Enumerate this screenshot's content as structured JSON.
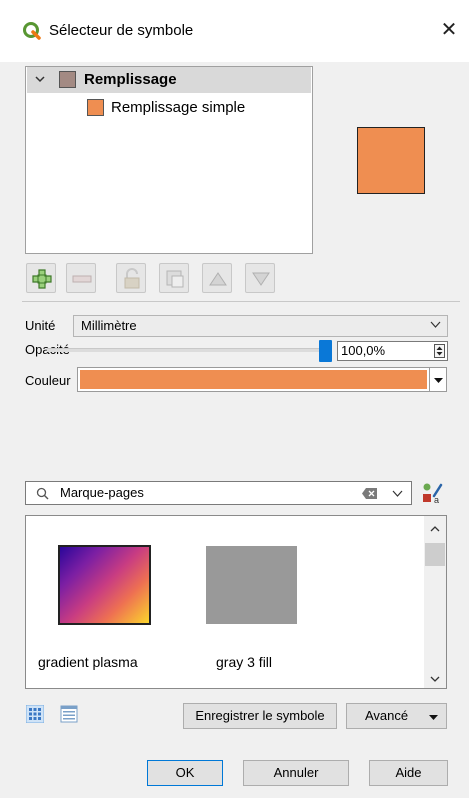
{
  "window": {
    "title": "Sélecteur de symbole"
  },
  "tree": {
    "root_label": "Remplissage",
    "root_color": "#a38a83",
    "child_label": "Remplissage simple",
    "child_color": "#ef8e51"
  },
  "preview": {
    "fill_color": "#ef8e51"
  },
  "layer_toolbar": {
    "icons": [
      "add-layer-icon",
      "remove-layer-icon",
      "lock-icon",
      "duplicate-layer-icon",
      "move-up-icon",
      "move-down-icon"
    ]
  },
  "properties": {
    "unit_label": "Unité",
    "unit_value": "Millimètre",
    "opacity_label": "Opacité",
    "opacity_value": "100,0%",
    "opacity_fraction": 1.0,
    "color_label": "Couleur",
    "color_value": "#ef8e51"
  },
  "search": {
    "value": "Marque-pages"
  },
  "gallery": {
    "items": [
      {
        "label": "gradient  plasma"
      },
      {
        "label": "gray 3 fill"
      }
    ]
  },
  "actions": {
    "save_symbol": "Enregistrer le symbole",
    "advanced": "Avancé"
  },
  "dialog_buttons": {
    "ok": "OK",
    "cancel": "Annuler",
    "help": "Aide"
  }
}
